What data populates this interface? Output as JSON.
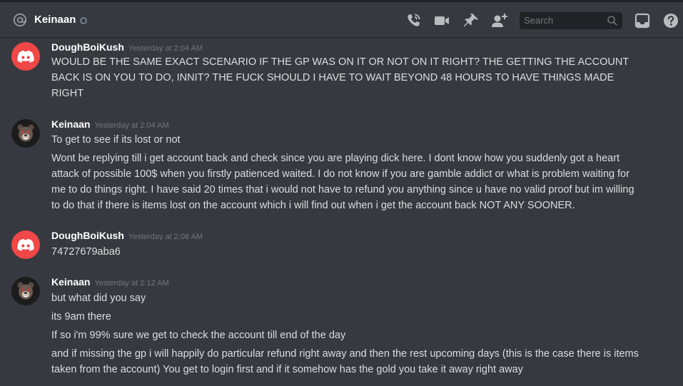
{
  "header": {
    "channel_name": "Keinaan",
    "search_placeholder": "Search",
    "icons": [
      "at-icon",
      "call-icon",
      "video-icon",
      "pin-icon",
      "add-friend-icon",
      "search-icon",
      "inbox-icon",
      "help-icon"
    ]
  },
  "messages": [
    {
      "author": "DoughBoiKush",
      "timestamp": "Yesterday at 2:04 AM",
      "avatar": "discord-logo",
      "lines": [
        "WOULD BE THE SAME EXACT SCENARIO IF THE GP WAS ON IT OR NOT ON IT RIGHT? THE GETTING THE ACCOUNT BACK IS ON YOU TO DO, INNIT? THE FUCK SHOULD I HAVE TO WAIT BEYOND 48 HOURS TO HAVE THINGS MADE RIGHT"
      ]
    },
    {
      "author": "Keinaan",
      "timestamp": "Yesterday at 2:04 AM",
      "avatar": "bear-face",
      "lines": [
        "To get to see if its lost or not",
        "Wont be replying till i get account back and check since you are playing dick here. I dont know how you suddenly got a heart attack of possible 100$ when you firstly patienced waited. I do not know if you are gamble addict or what is problem waiting for me to do things right. I have said 20 times that i would not have to refund you anything since u have no valid proof but im willing to do that if there is items lost on the account which i will find out when i get the account back NOT ANY SOONER."
      ]
    },
    {
      "author": "DoughBoiKush",
      "timestamp": "Yesterday at 2:06 AM",
      "avatar": "discord-logo",
      "lines": [
        "74727679aba6"
      ]
    },
    {
      "author": "Keinaan",
      "timestamp": "Yesterday at 2:12 AM",
      "avatar": "bear-face",
      "lines": [
        "but what did you say",
        "its 9am there",
        "If so i'm 99% sure we get to check the account till end of the day",
        "and if missing the gp i will happily do particular refund right away and then the rest upcoming days (this is the case there is items taken from the account) You get to login first and if it somehow has the gold you take it away right away"
      ]
    }
  ],
  "colors": {
    "background": "#36393f",
    "text": "#dcddde",
    "muted": "#72767d",
    "discord_red": "#f04747"
  }
}
